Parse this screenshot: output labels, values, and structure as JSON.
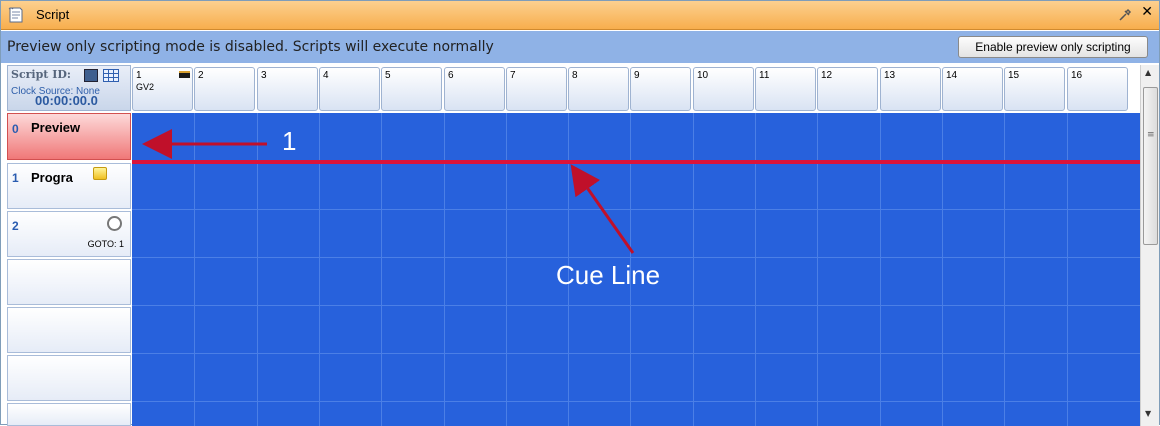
{
  "window": {
    "title": "Script",
    "pin_icon": "pin-icon",
    "close_label": "✕"
  },
  "infobar": {
    "message": "Preview only scripting mode is disabled.  Scripts will execute normally",
    "enable_button": "Enable preview only scripting"
  },
  "script_header": {
    "script_id_label": "Script ID:",
    "clock_source": "Clock Source: None",
    "clock_time": "00:00:00.0"
  },
  "columns": [
    {
      "num": "1",
      "source": "GV2"
    },
    {
      "num": "2"
    },
    {
      "num": "3"
    },
    {
      "num": "4"
    },
    {
      "num": "5"
    },
    {
      "num": "6"
    },
    {
      "num": "7"
    },
    {
      "num": "8"
    },
    {
      "num": "9"
    },
    {
      "num": "10"
    },
    {
      "num": "11"
    },
    {
      "num": "12"
    },
    {
      "num": "13"
    },
    {
      "num": "14"
    },
    {
      "num": "15"
    },
    {
      "num": "16"
    }
  ],
  "rows": [
    {
      "num": "0",
      "name": "Preview"
    },
    {
      "num": "1",
      "name": "Progra"
    },
    {
      "num": "2",
      "name": "",
      "sub": "GOTO: 1"
    }
  ],
  "annotations": {
    "marker_one": "1",
    "cue_line": "Cue Line"
  },
  "colors": {
    "grid_bg": "#2761dc",
    "cue_line": "#d9143a",
    "preview_row": "#f07878",
    "titlebar": "#f7ae4d",
    "infobar": "#8fb2e6"
  }
}
